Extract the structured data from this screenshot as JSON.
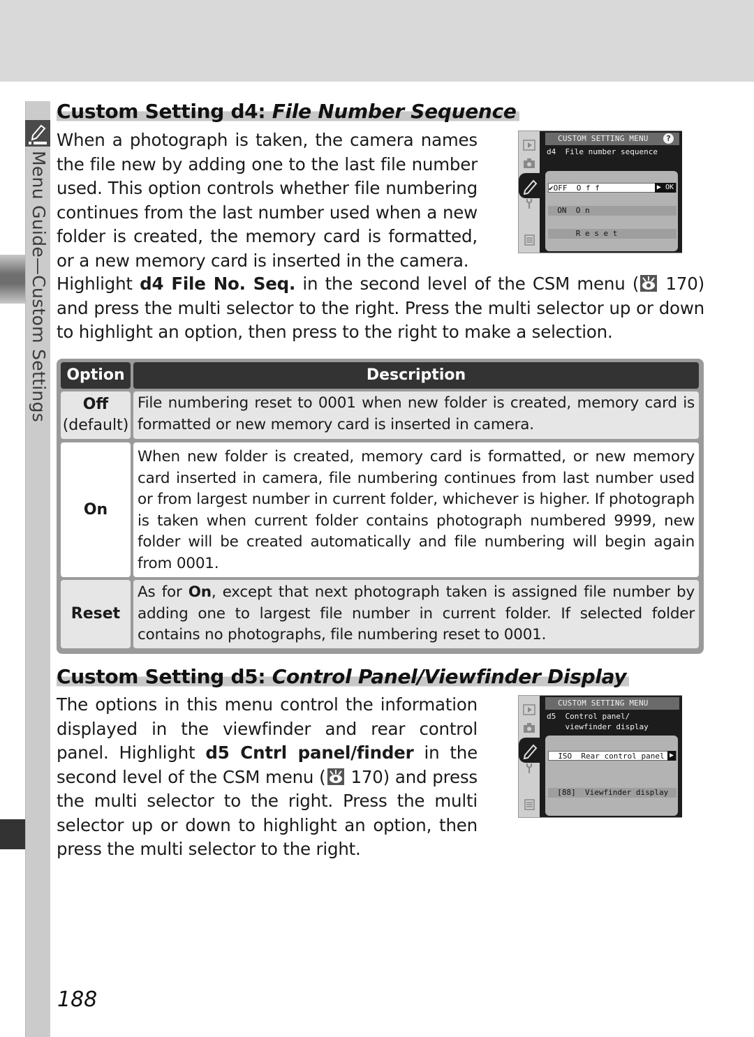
{
  "side_tab": {
    "label": "Menu Guide—Custom Settings",
    "icon": "pencil-icon"
  },
  "d4": {
    "title_prefix": "Custom Setting d4: ",
    "title_italic": "File Number Sequence",
    "intro": "When a photograph is taken, the camera names the file new by adding one to the last file number used.  This option controls whether file numbering continues from the last number used when a new folder is created, the memory card is formatted, or a new memory card is inserted in the camera.",
    "instr_1": "Highlight ",
    "instr_bold": "d4 File No. Seq.",
    "instr_2": " in the second level of the CSM menu (",
    "instr_ref": " 170) and press the multi selector to the right.  Press the multi selector up or down to highlight an option, then press to the right to make a selection.",
    "screen": {
      "header": "CUSTOM SETTING MENU",
      "help": "?",
      "subtitle": "d4  File number sequence",
      "options": [
        {
          "label": "✔OFF  O f f",
          "selected": true,
          "action": "▶ OK"
        },
        {
          "label": "  ON  O n",
          "selected": false
        },
        {
          "label": "      R e s e t",
          "selected": false
        }
      ]
    }
  },
  "table": {
    "headers": [
      "Option",
      "Description"
    ],
    "rows": [
      {
        "option": "Off",
        "option_note": "(default)",
        "description": "File numbering reset to 0001 when new folder is created, memory card is formatted or new memory card is inserted in camera."
      },
      {
        "option": "On",
        "description": "When new folder is created, memory card is formatted, or new memory card inserted in camera, file numbering continues from last number used or from largest number in current folder, whichever is higher.  If photograph is taken when current folder contains photograph numbered 9999, new folder will be created automatically and file numbering will begin again from 0001."
      },
      {
        "option": "Reset",
        "description_pre": "As for ",
        "description_bold": "On",
        "description_post": ", except that next photograph taken is assigned file number by adding one to largest file number in current folder.  If selected folder contains no photographs, file numbering reset to 0001."
      }
    ]
  },
  "d5": {
    "title_prefix": "Custom Setting d5: ",
    "title_italic": "Control Panel/Viewfinder Display",
    "intro_1": "The options in this menu control the information displayed in the viewfinder and rear control panel.  Highlight ",
    "intro_bold": "d5 Cntrl panel/finder",
    "intro_2": " in the second level of the CSM menu (",
    "intro_ref": " 170) and press the multi selector to the right.  Press the multi selector up or down to highlight an option, then press the multi selector to the right.",
    "screen": {
      "header": "CUSTOM SETTING MENU",
      "subtitle": "d5  Control panel/\n    viewfinder display",
      "options": [
        {
          "label": "  ISO  Rear control panel",
          "selected": true,
          "action": "▶"
        },
        {
          "label": "  [88]  Viewfinder display",
          "selected": false
        }
      ]
    }
  },
  "page_number": "188"
}
